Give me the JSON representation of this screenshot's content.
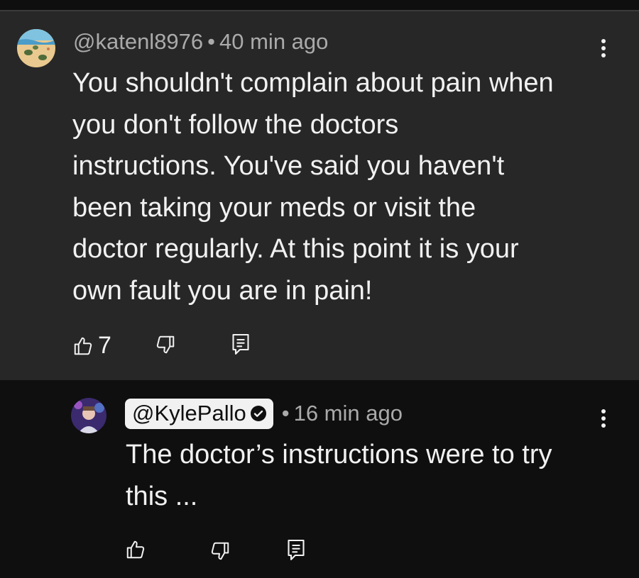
{
  "comments": [
    {
      "author": "@katenl8976",
      "separator": "•",
      "time": "40 min ago",
      "text": "You shouldn't complain about pain when\nyou don't follow the doctors\ninstructions. You've said you haven't\nbeen taking your meds or visit the\ndoctor regularly. At this point it is your\nown fault you are in pain!",
      "likes": "7",
      "icons": {
        "like": "thumbs-up-icon",
        "dislike": "thumbs-down-icon",
        "reply": "reply-icon",
        "more": "more-vert-icon"
      }
    },
    {
      "author": "@KylePallo",
      "verified": true,
      "separator": "•",
      "time": "16 min ago",
      "text": "The doctor’s instructions were to try\nthis ...",
      "likes": "",
      "icons": {
        "like": "thumbs-up-icon",
        "dislike": "thumbs-down-icon",
        "reply": "reply-icon",
        "more": "more-vert-icon"
      }
    }
  ],
  "colors": {
    "highlight_background": "#272727",
    "background": "#0f0f0f",
    "text": "#f1f1f1",
    "secondary_text": "#aaaaaa",
    "handle_badge": "#f1f1f1"
  }
}
